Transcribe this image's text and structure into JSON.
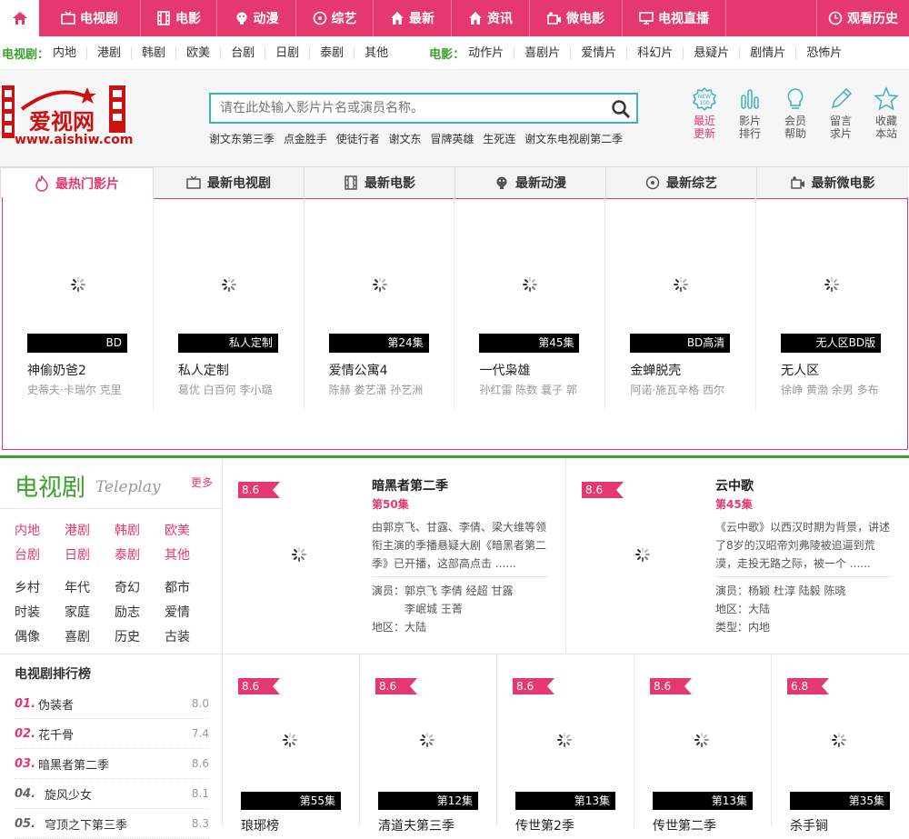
{
  "nav": {
    "items": [
      {
        "label": "电视剧",
        "icon": "tv-icon"
      },
      {
        "label": "电影",
        "icon": "film-icon"
      },
      {
        "label": "动漫",
        "icon": "anime-icon"
      },
      {
        "label": "综艺",
        "icon": "disc-icon"
      },
      {
        "label": "最新",
        "icon": "house-icon"
      },
      {
        "label": "资讯",
        "icon": "house-icon"
      },
      {
        "label": "微电影",
        "icon": "camera-icon"
      },
      {
        "label": "电视直播",
        "icon": "monitor-icon"
      },
      {
        "label": "观看历史",
        "icon": "clock-icon"
      }
    ]
  },
  "subnav": {
    "tv_label": "电视剧：",
    "tv_links": [
      "内地",
      "港剧",
      "韩剧",
      "欧美",
      "台剧",
      "日剧",
      "泰剧",
      "其他"
    ],
    "movie_label": "电影：",
    "movie_links": [
      "动作片",
      "喜剧片",
      "爱情片",
      "科幻片",
      "悬疑片",
      "剧情片",
      "恐怖片"
    ]
  },
  "logo": {
    "name": "爱视网",
    "url_text": "www.aishiw.com"
  },
  "search": {
    "placeholder": "请在此处输入影片片名或演员名称。",
    "hot": [
      "谢文东第三季",
      "点金胜手",
      "使徒行者",
      "谢文东",
      "冒牌英雄",
      "生死连",
      "谢文东电视剧第二季"
    ]
  },
  "quick": [
    {
      "l1": "最近",
      "l2": "更新",
      "icon": "new-icon"
    },
    {
      "l1": "影片",
      "l2": "排行",
      "icon": "chart-icon"
    },
    {
      "l1": "会员",
      "l2": "帮助",
      "icon": "bulb-icon"
    },
    {
      "l1": "留言",
      "l2": "求片",
      "icon": "pen-icon"
    },
    {
      "l1": "收藏",
      "l2": "本站",
      "icon": "star-icon"
    }
  ],
  "tabs": [
    "最热门影片",
    "最新电视剧",
    "最新电影",
    "最新动漫",
    "最新综艺",
    "最新微电影"
  ],
  "hot": [
    {
      "badge": "BD",
      "title": "神偷奶爸2",
      "actors": "史蒂夫·卡瑞尔 克里"
    },
    {
      "badge": "私人定制",
      "title": "私人定制",
      "actors": "葛优 白百何 李小璐"
    },
    {
      "badge": "第24集",
      "title": "爱情公寓4",
      "actors": "陈赫 娄艺潇 孙艺洲"
    },
    {
      "badge": "第45集",
      "title": "一代枭雄",
      "actors": "孙红雷 陈数 蘘子 郭"
    },
    {
      "badge": "BD高清",
      "title": "金蝉脱壳",
      "actors": "阿诺·施瓦辛格 西尔"
    },
    {
      "badge": "无人区BD版",
      "title": "无人区",
      "actors": "徐峥 黄渤 余男 多布"
    }
  ],
  "tv": {
    "title": "电视剧",
    "subtitle": "Teleplay",
    "more": "更多",
    "regions": [
      "内地",
      "港剧",
      "韩剧",
      "欧美",
      "台剧",
      "日剧",
      "泰剧",
      "其他"
    ],
    "genres": [
      "乡村",
      "年代",
      "奇幻",
      "都市",
      "时装",
      "家庭",
      "励志",
      "爱情",
      "偶像",
      "喜剧",
      "历史",
      "古装"
    ],
    "rank_title": "电视剧排行榜",
    "rank": [
      {
        "n": "01.",
        "name": "伪装者",
        "score": "8.0"
      },
      {
        "n": "02.",
        "name": "花千骨",
        "score": "7.4"
      },
      {
        "n": "03.",
        "name": "暗黑者第二季",
        "score": "8.6"
      },
      {
        "n": "04.",
        "name": "旋风少女",
        "score": "8.1"
      },
      {
        "n": "05.",
        "name": "穹顶之下第三季",
        "score": "8.3"
      }
    ]
  },
  "featured": [
    {
      "score": "8.6",
      "title": "暗黑者第二季",
      "ep": "第50集",
      "desc": "由郭京飞、甘露、李倩、梁大维等领衔主演的季播悬疑大剧《暗黑者第二季》已开播，这部高点击 ......",
      "actors_label": "演员：",
      "actors_l1": "郭京飞   李倩   经超   甘露",
      "actors_l2": "李岷城   王菁",
      "region": "地区：大陆"
    },
    {
      "score": "8.6",
      "title": "云中歌",
      "ep": "第45集",
      "desc": "《云中歌》以西汉时期为背景，讲述了8岁的汉昭帝刘弗陵被追逼到荒漠，走投无路之际，被一个 ......",
      "actors_label": "演员：",
      "actors_l1": "杨颖   杜淳   陆毅   陈晓",
      "region": "地区：大陆",
      "type": "类型：内地"
    }
  ],
  "small": [
    {
      "score": "8.6",
      "badge": "第55集",
      "title": "琅琊榜"
    },
    {
      "score": "8.6",
      "badge": "第12集",
      "title": "清道夫第三季"
    },
    {
      "score": "8.6",
      "badge": "第13集",
      "title": "传世第2季"
    },
    {
      "score": "8.6",
      "badge": "第13集",
      "title": "传世第二季"
    },
    {
      "score": "6.8",
      "badge": "第35集",
      "title": "杀手锏"
    }
  ],
  "colors": {
    "accent": "#e5386e",
    "green": "#3aa22c",
    "search_border": "#3cb0c4"
  }
}
